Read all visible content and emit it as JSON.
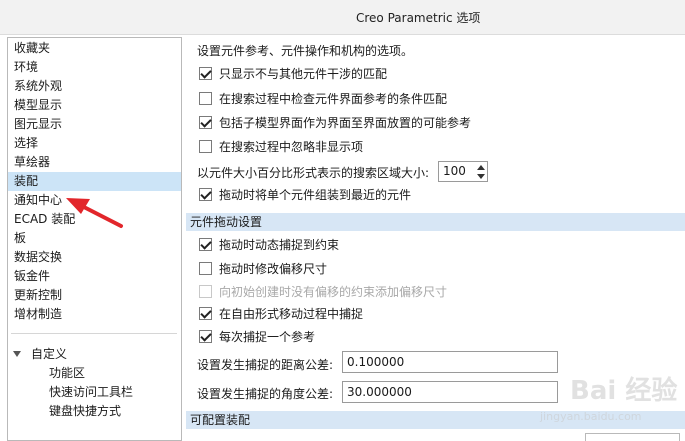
{
  "window": {
    "title": "Creo Parametric 选项"
  },
  "sidebar": {
    "items": [
      {
        "label": "收藏夹"
      },
      {
        "label": "环境"
      },
      {
        "label": "系统外观"
      },
      {
        "label": "模型显示"
      },
      {
        "label": "图元显示"
      },
      {
        "label": "选择"
      },
      {
        "label": "草绘器"
      },
      {
        "label": "装配",
        "selected": true
      },
      {
        "label": "通知中心"
      },
      {
        "label": "ECAD 装配"
      },
      {
        "label": "板"
      },
      {
        "label": "数据交换"
      },
      {
        "label": "钣金件"
      },
      {
        "label": "更新控制"
      },
      {
        "label": "增材制造"
      }
    ],
    "custom": {
      "label": "自定义",
      "children": [
        "功能区",
        "快速访问工具栏",
        "键盘快捷方式"
      ]
    }
  },
  "main": {
    "description": "设置元件参考、元件操作和机构的选项。",
    "options_top": [
      {
        "label": "只显示不与其他元件干涉的匹配",
        "checked": true
      },
      {
        "label": "在搜索过程中检查元件界面参考的条件匹配",
        "checked": false
      },
      {
        "label": "包括子模型界面作为界面至界面放置的可能参考",
        "checked": true
      },
      {
        "label": "在搜索过程中忽略非显示项",
        "checked": false
      }
    ],
    "search_region": {
      "label": "以元件大小百分比形式表示的搜索区域大小:",
      "value": "100"
    },
    "drag_single": {
      "label": "拖动时将单个元件组装到最近的元件",
      "checked": true
    },
    "section_drag": {
      "title": "元件拖动设置"
    },
    "options_drag": [
      {
        "label": "拖动时动态捕捉到约束",
        "checked": true,
        "disabled": false
      },
      {
        "label": "拖动时修改偏移尺寸",
        "checked": false,
        "disabled": false
      },
      {
        "label": "向初始创建时没有偏移的约束添加偏移尺寸",
        "checked": false,
        "disabled": true
      },
      {
        "label": "在自由形式移动过程中捕捉",
        "checked": true,
        "disabled": false
      },
      {
        "label": "每次捕捉一个参考",
        "checked": true,
        "disabled": false
      }
    ],
    "snap_distance": {
      "label": "设置发生捕捉的距离公差:",
      "value": "0.100000"
    },
    "snap_angle": {
      "label": "设置发生捕捉的角度公差:",
      "value": "30.000000"
    },
    "section_config": {
      "title": "可配置装配"
    }
  },
  "watermark": {
    "main": "Bai 经验",
    "sub": "jingyan.baidu.com"
  },
  "colors": {
    "selected": "#cce4f7",
    "section": "#d7e6f5",
    "arrow": "#e2262b"
  }
}
